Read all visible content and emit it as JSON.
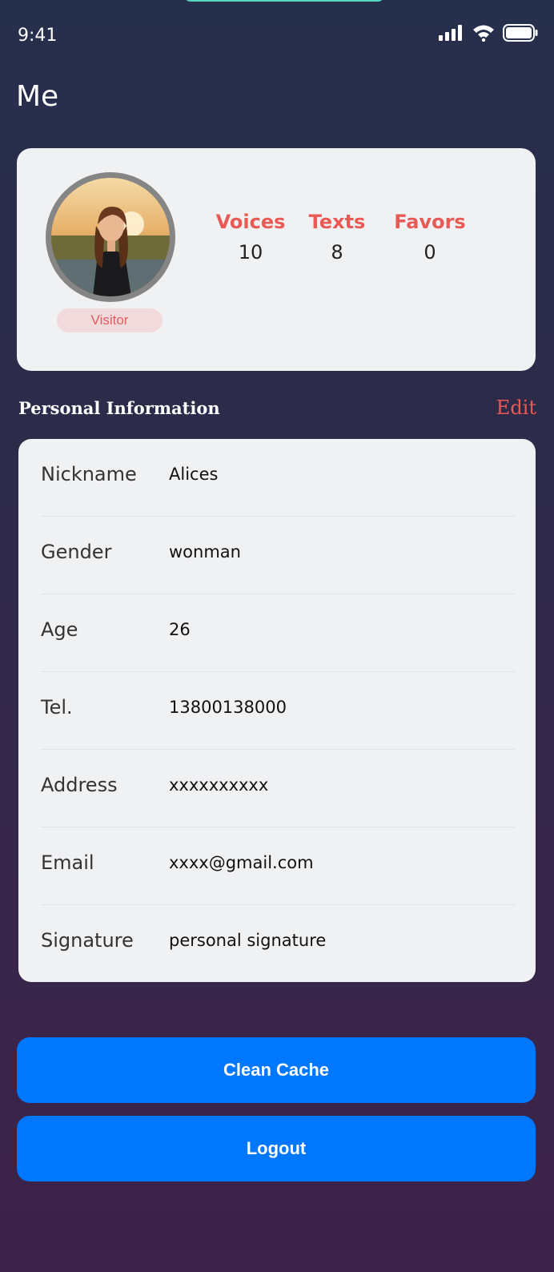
{
  "status_bar": {
    "time": "9:41"
  },
  "header": {
    "title": "Me"
  },
  "profile": {
    "role_badge": "Visitor",
    "stats": [
      {
        "label": "Voices",
        "value": "10"
      },
      {
        "label": "Texts",
        "value": "8"
      },
      {
        "label": "Favors",
        "value": "0"
      }
    ]
  },
  "personal_info": {
    "title": "Personal Information",
    "edit_label": "Edit",
    "rows": [
      {
        "label": "Nickname",
        "value": "Alices"
      },
      {
        "label": "Gender",
        "value": "wonman"
      },
      {
        "label": "Age",
        "value": "26"
      },
      {
        "label": "Tel.",
        "value": "13800138000"
      },
      {
        "label": "Address",
        "value": "xxxxxxxxxx"
      },
      {
        "label": "Email",
        "value": "xxxx@gmail.com"
      },
      {
        "label": "Signature",
        "value": "personal signature"
      }
    ]
  },
  "actions": {
    "clean_cache_label": "Clean Cache",
    "logout_label": "Logout"
  },
  "colors": {
    "accent": "#e85a55",
    "primary_button": "#0077ff",
    "card_background": "#f0f1f3"
  }
}
